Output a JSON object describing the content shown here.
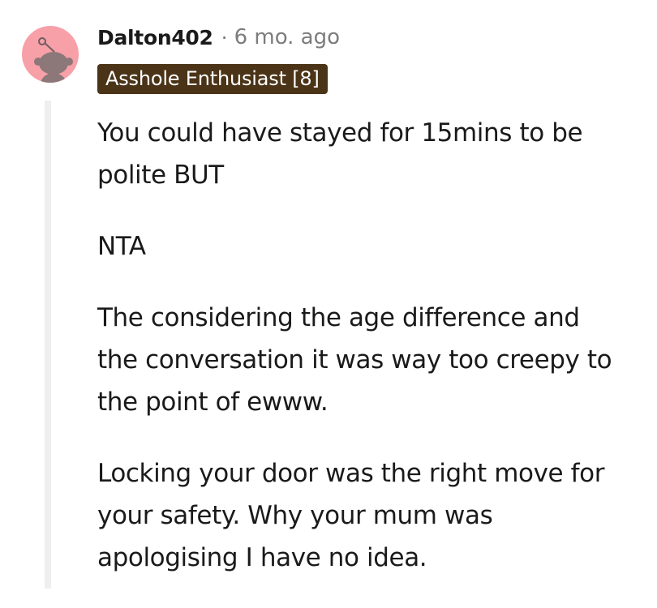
{
  "comment": {
    "author": "Dalton402",
    "separator": "·",
    "timestamp": "6 mo. ago",
    "flair": "Asshole Enthusiast [8]",
    "paragraphs": [
      {
        "lines": [
          "You could have stayed for 15mins to be",
          "polite BUT"
        ]
      },
      {
        "lines": [
          "NTA"
        ]
      },
      {
        "lines": [
          "The considering the age difference and",
          "the conversation it was way too creepy to",
          "the point of ewww."
        ]
      },
      {
        "lines": [
          "Locking your door was the right move for",
          "your safety. Why your mum was",
          "apologising I have no idea."
        ]
      }
    ]
  },
  "colors": {
    "avatar_bg": "#f7a0a8",
    "flair_bg": "#4a3317",
    "flair_text": "#ffffff",
    "meta_text": "#7c7c7c",
    "thread_line": "#edeff1"
  },
  "icons": {
    "avatar": "snoo-avatar-icon"
  }
}
